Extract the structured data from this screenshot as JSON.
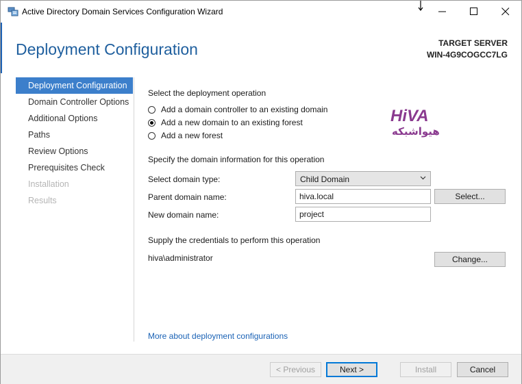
{
  "window": {
    "title": "Active Directory Domain Services Configuration Wizard"
  },
  "header": {
    "page_title": "Deployment Configuration",
    "target_label": "TARGET SERVER",
    "target_name": "WIN-4G9COGCC7LG"
  },
  "nav": {
    "items": [
      {
        "label": "Deployment Configuration",
        "state": "active"
      },
      {
        "label": "Domain Controller Options",
        "state": "normal"
      },
      {
        "label": "Additional Options",
        "state": "normal"
      },
      {
        "label": "Paths",
        "state": "normal"
      },
      {
        "label": "Review Options",
        "state": "normal"
      },
      {
        "label": "Prerequisites Check",
        "state": "normal"
      },
      {
        "label": "Installation",
        "state": "disabled"
      },
      {
        "label": "Results",
        "state": "disabled"
      }
    ]
  },
  "main": {
    "operation_heading": "Select the deployment operation",
    "operations": [
      {
        "label": "Add a domain controller to an existing domain",
        "checked": false
      },
      {
        "label": "Add a new domain to an existing forest",
        "checked": true
      },
      {
        "label": "Add a new forest",
        "checked": false
      }
    ],
    "domain_info_heading": "Specify the domain information for this operation",
    "domain_type_label": "Select domain type:",
    "domain_type_value": "Child Domain",
    "parent_domain_label": "Parent domain name:",
    "parent_domain_value": "hiva.local",
    "select_button": "Select...",
    "new_domain_label": "New domain name:",
    "new_domain_value": "project",
    "credentials_heading": "Supply the credentials to perform this operation",
    "credentials_user": "hiva\\administrator",
    "change_button": "Change...",
    "more_link": "More about deployment configurations"
  },
  "watermark": {
    "text": "HiVA",
    "subtext": "هیواشبکه"
  },
  "footer": {
    "previous_label": "< Previous",
    "next_label": "Next >",
    "install_label": "Install",
    "cancel_label": "Cancel"
  },
  "colors": {
    "accent": "#3c7fcb",
    "title_blue": "#1f5f9e",
    "link_blue": "#1a62b5",
    "watermark_purple": "#8a3a8f"
  }
}
